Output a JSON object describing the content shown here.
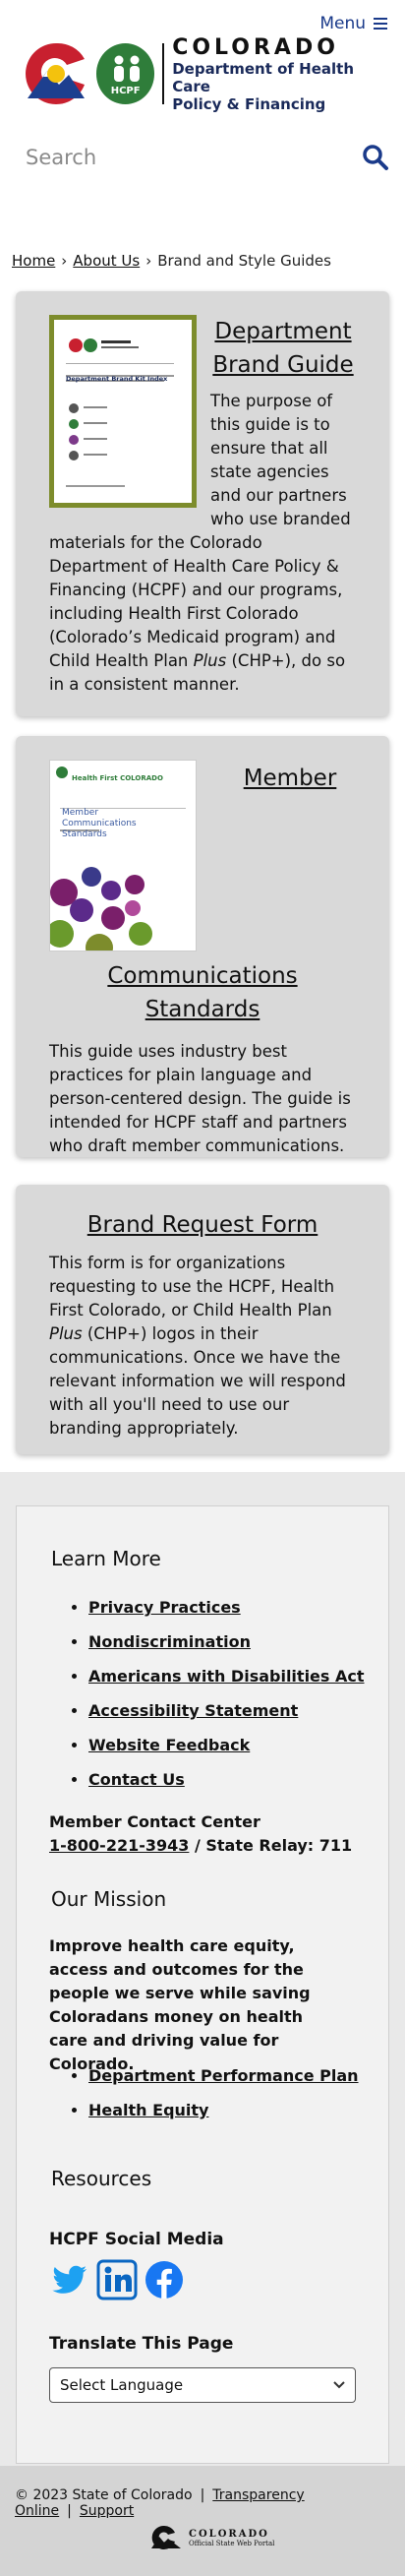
{
  "header": {
    "menu_label": "Menu",
    "logo_word": "COLORADO",
    "logo_dept_line1": "Department of Health Care",
    "logo_dept_line2": "Policy & Financing",
    "hcpf_badge": "HCPF"
  },
  "search": {
    "placeholder": "Search"
  },
  "breadcrumb": {
    "home": "Home",
    "about": "About Us",
    "current": "Brand and Style Guides",
    "separator": "›"
  },
  "cards": [
    {
      "title_line1": "Department",
      "title_line2": "Brand Guide",
      "body_before_plus": "The purpose of this guide is to ensure that all state agencies and our partners who use branded materials for the Colorado Department of Health Care Policy & Financing (HCPF) and our programs, including Health First Colorado (Colorado’s Medicaid program) and Child Health Plan ",
      "plus": "Plus",
      "body_after_plus": " (CHP+), do so in a consistent manner.",
      "thumb_title": "Department Brand Kit Index"
    },
    {
      "title_line1": "Member",
      "title_line2": "Communications Standards",
      "body": "This guide uses industry best practices for plain language and person-centered design. The guide is intended for HCPF staff and partners who draft member communications.",
      "thumb_title": "Member Communications Standards",
      "thumb_brand": "Health First COLORADO"
    },
    {
      "title": "Brand Request Form",
      "body_before_plus": "This form is for organizations requesting to use the HCPF, Health First Colorado, or Child Health Plan ",
      "plus": "Plus",
      "body_after_plus": " (CHP+) logos in their communications. Once we have the relevant information we will respond with all you'll need to use our branding appropriately."
    }
  ],
  "footer": {
    "learn_more_heading": "Learn More",
    "learn_more_links": [
      "Privacy Practices",
      "Nondiscrimination",
      "Americans with Disabilities Act",
      "Accessibility Statement",
      "Website Feedback",
      "Contact Us"
    ],
    "contact_label": "Member Contact Center",
    "contact_phone": "1-800-221-3943",
    "contact_relay": " / State Relay: 711",
    "mission_heading": "Our Mission",
    "mission_text": "Improve health care equity, access and outcomes for the people we serve while saving Coloradans money on health care and driving value for Colorado.",
    "mission_links": [
      "Department Performance Plan",
      "Health Equity"
    ],
    "resources_heading": "Resources",
    "social_heading": "HCPF Social Media",
    "social_icons": [
      "twitter-icon",
      "linkedin-icon",
      "facebook-icon"
    ],
    "translate_heading": "Translate This Page",
    "language_select": "Select Language"
  },
  "bottom": {
    "copyright": "© 2023 State of Colorado",
    "transparency": "Transparency Online",
    "support": "Support",
    "portal_word": "COLORADO",
    "portal_sub": "Official State Web Portal"
  },
  "colors": {
    "accent": "#1a3a8a",
    "hcpf_green": "#2f7d3a",
    "card_bg": "#d9d9d9",
    "thumb_border": "#7d8c2c"
  }
}
